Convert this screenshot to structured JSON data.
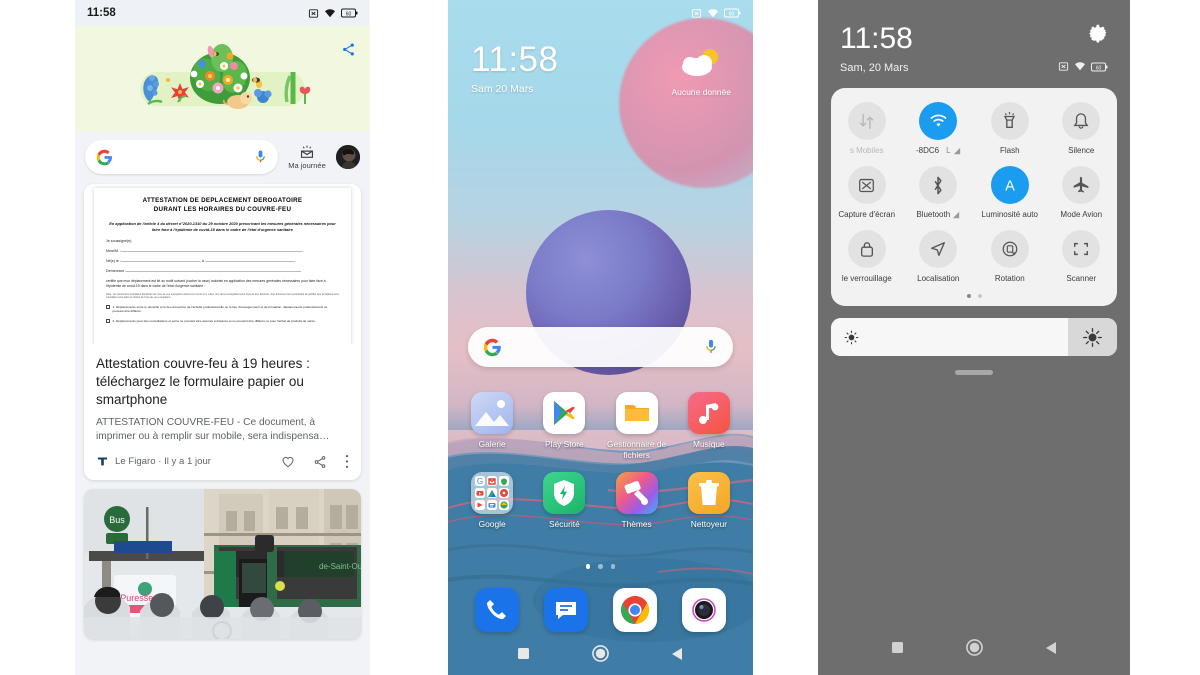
{
  "phone1": {
    "status": {
      "time": "11:58",
      "battery": "60"
    },
    "doodle": {
      "name": "google-spring-doodle",
      "bg_color": "#f2f8e0"
    },
    "search": {
      "placeholder": "",
      "value": "",
      "my_day_label": "Ma journée"
    },
    "article": {
      "doc_title_line1": "ATTESTATION DE DEPLACEMENT DEROGATOIRE",
      "doc_title_line2": "DURANT LES HORAIRES DU COUVRE-FEU",
      "doc_sub": "En application de l'article 4 du décret n°2020-1310 du 29 octobre 2020 prescrivant les mesures générales nécessaires pour faire face à l'épidémie de covid-19 dans le cadre de l'état d'urgence sanitaire",
      "doc_f0": "Je soussigné(e),",
      "doc_f1": "Mme/M. :",
      "doc_f2": "Né(e) le :",
      "doc_f2b": ", à :",
      "doc_f3": "Demeurant :",
      "doc_body": "certifie que mon déplacement est lié au motif suivant (cocher la case) autorisé en application des mesures générales nécessaires pour faire face à l'épidémie de covid-19 dans le cadre de l'état d'urgence sanitaire :",
      "doc_note": "Nota : les personnes souhaitant bénéficier de l'une de ces exceptions doivent se munir s'il y a lieu, lors de leurs déplacements hors de leur domicile, d'un document leur permettant de justifier que le déplacement considéré entre dans le champ de l'une de ces exceptions.",
      "doc_c1": "1. Déplacements entre le domicile et le lieu d'exercice de l'activité professionnelle ou le lieu d'enseignement et de formation, déplacements professionnels ne pouvant être différés.",
      "doc_c2": "2. Déplacements pour des consultations et soins ne pouvant être assurés à distance et ne pouvant être différés ou pour l'achat de produits de santé.",
      "title": "Attestation couvre-feu à 19 heures : téléchargez le formulaire papier ou smartphone",
      "snippet": "ATTESTATION COUVRE-FEU - Ce document, à imprimer ou à remplir sur mobile, sera indispensa…",
      "source": "Le Figaro",
      "time_ago": "Il y a 1 jour",
      "separator": "·"
    },
    "photo_card": {
      "name": "paris-bus-stop-photo"
    }
  },
  "phone2": {
    "status": {
      "battery": "60"
    },
    "clock": {
      "time": "11:58",
      "date": "Sam 20 Mars"
    },
    "weather": {
      "label": "Aucune donnée",
      "icon": "partly-cloudy-icon"
    },
    "search_widget": {
      "placeholder": "",
      "value": ""
    },
    "apps_row1": [
      {
        "label": "Galerie",
        "icon": "gallery-icon"
      },
      {
        "label": "Play Store",
        "icon": "play-store-icon"
      },
      {
        "label": "Gestionnaire de fichiers",
        "icon": "file-manager-icon"
      },
      {
        "label": "Musique",
        "icon": "music-icon"
      }
    ],
    "apps_row2": [
      {
        "label": "Google",
        "icon": "google-folder-icon"
      },
      {
        "label": "Sécurité",
        "icon": "security-icon"
      },
      {
        "label": "Thèmes",
        "icon": "themes-icon"
      },
      {
        "label": "Nettoyeur",
        "icon": "cleaner-icon"
      }
    ],
    "dock": [
      {
        "label": "Téléphone",
        "icon": "phone-icon"
      },
      {
        "label": "Messages",
        "icon": "messages-icon"
      },
      {
        "label": "Chrome",
        "icon": "chrome-icon"
      },
      {
        "label": "Appareil photo",
        "icon": "camera-icon"
      }
    ],
    "page_dots": {
      "count": 3,
      "active": 0
    },
    "nav": [
      "recents",
      "home",
      "back"
    ]
  },
  "phone3": {
    "header": {
      "time": "11:58",
      "date": "Sam, 20 Mars",
      "settings_icon": "gear-icon",
      "battery": "60"
    },
    "tiles": [
      {
        "label": "s Mobiles",
        "icon": "data-arrows-icon",
        "active": false
      },
      {
        "label": "-8DC6",
        "icon": "wifi-icon",
        "active": true,
        "badge": "L"
      },
      {
        "label": "Flash",
        "icon": "flashlight-icon",
        "active": false
      },
      {
        "label": "Silence",
        "icon": "bell-icon",
        "active": false
      },
      {
        "label": "Capture d'écran",
        "icon": "screenshot-icon",
        "active": false
      },
      {
        "label": "Bluetooth",
        "icon": "bluetooth-icon",
        "active": false,
        "badge": ""
      },
      {
        "label": "Luminosité auto",
        "icon": "auto-brightness-icon",
        "active": true
      },
      {
        "label": "Mode Avion",
        "icon": "airplane-icon",
        "active": false
      },
      {
        "label": "le verrouillage",
        "icon": "lock-icon",
        "active": false
      },
      {
        "label": "Localisation",
        "icon": "location-icon",
        "active": false
      },
      {
        "label": "Rotation",
        "icon": "rotation-icon",
        "active": false
      },
      {
        "label": "Scanner",
        "icon": "scanner-icon",
        "active": false
      }
    ],
    "panel_dots": {
      "count": 2,
      "active": 0
    },
    "brightness": {
      "value": 83,
      "low_icon": "brightness-low-icon",
      "high_icon": "brightness-high-icon"
    },
    "nav": [
      "recents",
      "home",
      "back"
    ],
    "accent_color": "#1a9cf0",
    "bg_color": "#6e6e6e"
  }
}
